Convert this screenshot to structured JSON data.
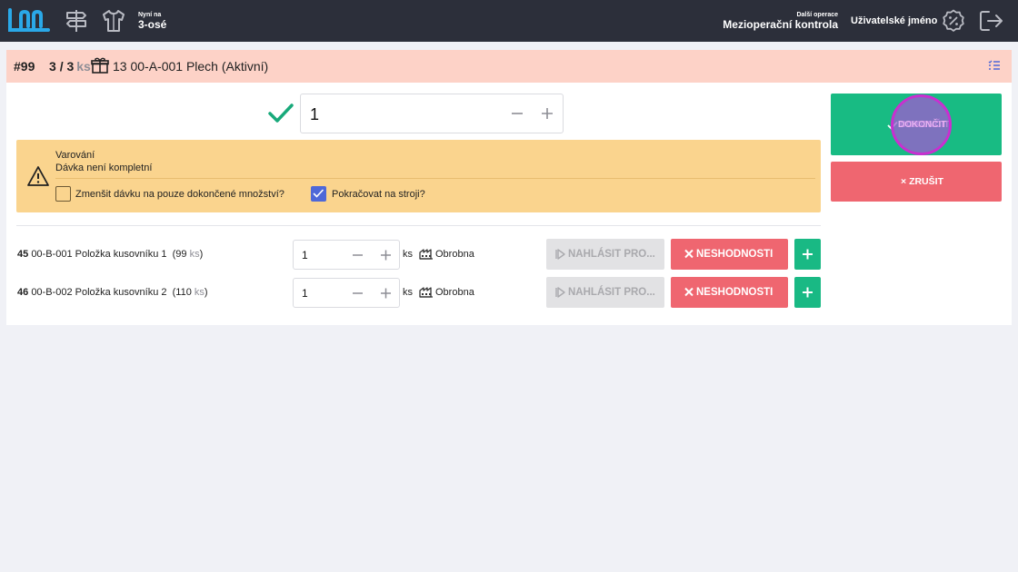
{
  "topbar": {
    "now_label": "Nyní na",
    "now_value": "3-osé",
    "next_label": "Další operace",
    "next_value": "Mezioperační kontrola",
    "username": "Uživatelské jméno",
    "icons": [
      "logo-icon",
      "signpost-icon",
      "shirt-icon",
      "percent-badge-icon",
      "logout-icon"
    ]
  },
  "header": {
    "order": "#99",
    "qty_done": "3",
    "qty_sep": "/",
    "qty_total": "3",
    "qty_unit": "ks",
    "product": "13 00-A-001 Plech (Aktivní)",
    "background": "#fdd2c7"
  },
  "main": {
    "quantity": "1",
    "warning": {
      "title": "Varování",
      "message": "Dávka není kompletní",
      "option_reduce": {
        "label": "Zmenšit dávku na pouze dokončené množství?",
        "checked": false
      },
      "option_continue": {
        "label": "Pokračovat na stroji?",
        "checked": true
      }
    },
    "items": [
      {
        "pos": "45",
        "code": "00-B-001 Položka kusovníku 1",
        "stock": "99",
        "stock_unit": "ks",
        "qty": "1",
        "unit": "ks",
        "workstation": "Obrobna"
      },
      {
        "pos": "46",
        "code": "00-B-002 Položka kusovníku 2",
        "stock": "110",
        "stock_unit": "ks",
        "qty": "1",
        "unit": "ks",
        "workstation": "Obrobna"
      }
    ],
    "report_label": "NAHLÁSIT PRO...",
    "ncr_label": "NESHODNOSTI"
  },
  "actions": {
    "finish_label": "DOKONČIT",
    "cancel_label": "ZRUŠIT",
    "finish_color": "#18bb83",
    "cancel_color": "#ef6670"
  }
}
